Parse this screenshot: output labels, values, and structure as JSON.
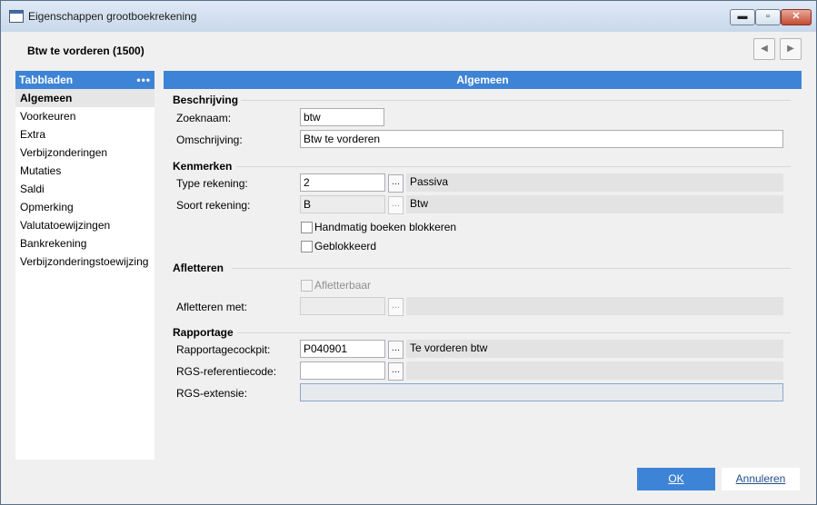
{
  "window": {
    "title": "Eigenschappen grootboekrekening",
    "minimize": "▬",
    "maximize": "▫",
    "close": "✕"
  },
  "header": {
    "title": "Btw te vorderen (1500)",
    "prev": "◀",
    "next": "▶"
  },
  "tabs": {
    "heading": "Tabbladen",
    "more": "•••",
    "items": [
      "Algemeen",
      "Voorkeuren",
      "Extra",
      "Verbijzonderingen",
      "Mutaties",
      "Saldi",
      "Opmerking",
      "Valutatoewijzingen",
      "Bankrekening",
      "Verbijzonderingstoewijzing"
    ]
  },
  "main": {
    "heading": "Algemeen",
    "beschrijving": {
      "title": "Beschrijving",
      "zoeknaam_label": "Zoeknaam:",
      "zoeknaam_value": "btw",
      "omschrijving_label": "Omschrijving:",
      "omschrijving_value": "Btw te vorderen"
    },
    "kenmerken": {
      "title": "Kenmerken",
      "type_label": "Type rekening:",
      "type_value": "2",
      "type_desc": "Passiva",
      "soort_label": "Soort rekening:",
      "soort_value": "B",
      "soort_desc": "Btw",
      "handmatig_label": "Handmatig boeken blokkeren",
      "geblokkeerd_label": "Geblokkeerd"
    },
    "afletteren": {
      "title": "Afletteren",
      "afletterbaar_label": "Afletterbaar",
      "met_label": "Afletteren met:",
      "met_value": ""
    },
    "rapportage": {
      "title": "Rapportage",
      "cockpit_label": "Rapportagecockpit:",
      "cockpit_value": "P040901",
      "cockpit_desc": "Te vorderen btw",
      "rgs_label": "RGS-referentiecode:",
      "rgs_value": "",
      "rgs_ext_label": "RGS-extensie:",
      "rgs_ext_value": ""
    },
    "lookup_glyph": "..."
  },
  "footer": {
    "ok": "OK",
    "cancel": "Annuleren"
  },
  "colors": {
    "accent": "#3e84d6"
  }
}
